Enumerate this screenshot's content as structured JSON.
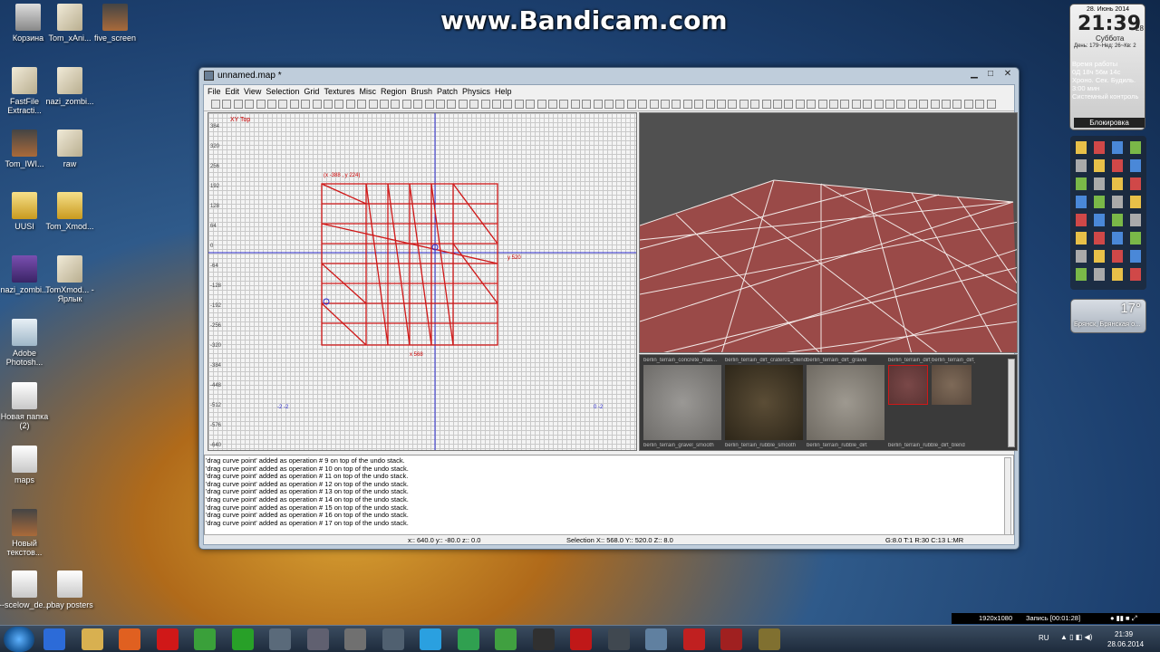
{
  "watermark": "www.Bandicam.com",
  "desktop": {
    "icons": [
      {
        "label": "Корзина"
      },
      {
        "label": "Tom_xAni..."
      },
      {
        "label": "five_screen"
      },
      {
        "label": "FastFile Extracti..."
      },
      {
        "label": "nazi_zombi..."
      },
      {
        "label": "Tom_IWI..."
      },
      {
        "label": "raw"
      },
      {
        "label": "UUSI"
      },
      {
        "label": "Tom_Xmod..."
      },
      {
        "label": "nazi_zombi..."
      },
      {
        "label": "TomXmod... - Ярлык"
      },
      {
        "label": "Adobe Photosh..."
      },
      {
        "label": "Новая папка (2)"
      },
      {
        "label": "maps"
      },
      {
        "label": "Новый текстов..."
      },
      {
        "label": "--scelow_de..."
      },
      {
        "label": "pbay posters"
      }
    ]
  },
  "window": {
    "title": "unnamed.map *",
    "menu": [
      "File",
      "Edit",
      "View",
      "Selection",
      "Grid",
      "Textures",
      "Misc",
      "Region",
      "Brush",
      "Patch",
      "Physics",
      "Help"
    ],
    "view2d": {
      "label": "XY Top",
      "y_ticks": [
        "384",
        "320",
        "256",
        "192",
        "128",
        "64",
        "0",
        "-64",
        "-128",
        "-192",
        "-256",
        "-320",
        "-384",
        "-448",
        "-512",
        "-576",
        "-640"
      ],
      "sel_top": "(x -388 , y 224)",
      "sel_right": "y 520",
      "sel_bottom": "x 568",
      "coord_left": "-2 -2",
      "coord_right": "0 -2"
    },
    "textures": [
      {
        "name": "berlin_terrain_concrete_mas...",
        "sub": "berlin_terrain_gravel_smooth",
        "color1": "#9a9895",
        "color2": "#6e6c69"
      },
      {
        "name": "berlin_terrain_dirt_crater01_blend",
        "sub": "berlin_terrain_rubble_smooth",
        "color1": "#5b4d36",
        "color2": "#2d2619"
      },
      {
        "name": "berlin_terrain_dirt_gravel",
        "sub": "berlin_terrain_rubble_dirt",
        "color1": "#9e9990",
        "color2": "#6e6961"
      },
      {
        "name": "berlin_terrain_dirt_rubble",
        "sub": "berlin_terrain_rubble_dirt_blend",
        "color1": "#7a4848",
        "color2": "#5b3434"
      },
      {
        "name": "berlin_terrain_dirt_rubble_mix",
        "sub": "",
        "color1": "#7e6a58",
        "color2": "#5a4a3e"
      }
    ],
    "console": [
      "'drag curve point' added as operation # 9 on top of the undo stack.",
      "'drag curve point' added as operation # 10 on top of the undo stack.",
      "'drag curve point' added as operation # 11 on top of the undo stack.",
      "'drag curve point' added as operation # 12 on top of the undo stack.",
      "'drag curve point' added as operation # 13 on top of the undo stack.",
      "'drag curve point' added as operation # 14 on top of the undo stack.",
      "'drag curve point' added as operation # 15 on top of the undo stack.",
      "'drag curve point' added as operation # 16 on top of the undo stack.",
      "'drag curve point' added as operation # 17 on top of the undo stack."
    ],
    "status": {
      "coords": "x:: 640.0  y:: -80.0  z:: 0.0",
      "selection": "Selection X:: 568.0  Y:: 520.0  Z:: 8.0",
      "grid": "G:8.0 T:1 R:30 C:13 L:MR"
    }
  },
  "gadgets": {
    "clock": {
      "date": "28. Июнь 2014",
      "time": "21:39",
      "seconds": "28",
      "weekday": "Суббота",
      "info": "День: 179~Нед: 26~Кв: 2"
    },
    "system": {
      "uptime_label": "Время работы",
      "uptime": "0Д 18ч 56м 14с",
      "chrono": "Хроно.  Сек.  Будиль.",
      "timer": "3:00 мин",
      "control": "Системный контроль",
      "lock": "Блокировка"
    },
    "weather": {
      "temp": "17°",
      "city": "Брянск, Брянская о..."
    }
  },
  "recorder": {
    "resolution": "1920x1080",
    "status": "Запись [00:01:28]"
  },
  "taskbar": {
    "lang": "RU",
    "time": "21:39",
    "date": "28.06.2014"
  },
  "colors": {
    "brush_wire": "#d01818",
    "axis": "#2b2bd0",
    "terrain": "#9a4a48"
  }
}
